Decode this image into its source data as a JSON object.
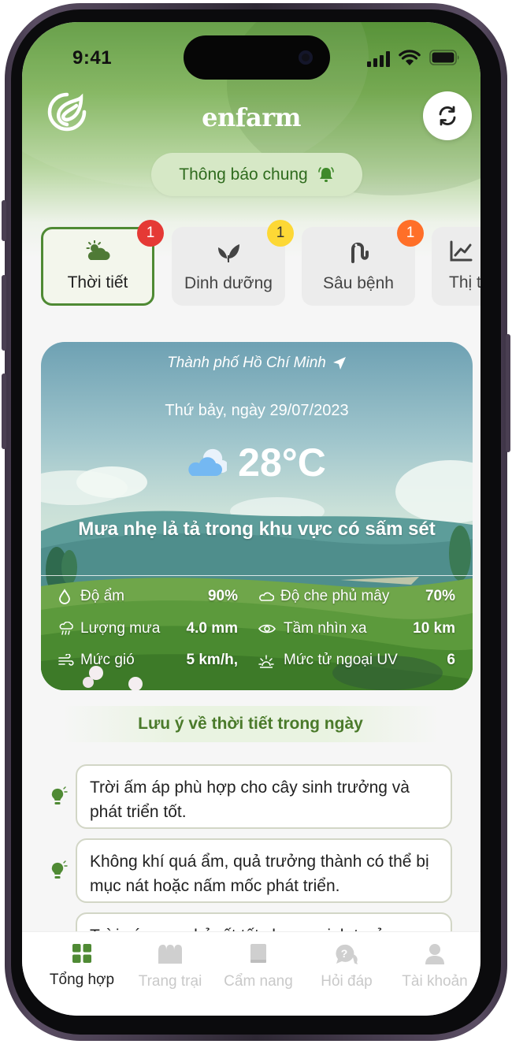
{
  "status_bar": {
    "time": "9:41"
  },
  "header": {
    "brand": "enfarm"
  },
  "notice": {
    "label": "Thông báo chung"
  },
  "tabs": [
    {
      "label": "Thời tiết",
      "badge": "1",
      "badge_color": "#e53935",
      "active": true,
      "icon": "weather-icon"
    },
    {
      "label": "Dinh dưỡng",
      "badge": "1",
      "badge_color": "#fdd835",
      "active": false,
      "icon": "leaf-icon"
    },
    {
      "label": "Sâu bệnh",
      "badge": "1",
      "badge_color": "#ff6f28",
      "active": false,
      "icon": "pest-icon"
    },
    {
      "label": "Thị tr",
      "badge": "",
      "active": false,
      "icon": "chart-icon"
    }
  ],
  "weather": {
    "city": "Thành phố Hồ Chí Minh",
    "date": "Thứ bảy, ngày 29/07/2023",
    "temperature": "28°C",
    "description": "Mưa nhẹ lả tả trong khu vực có sấm sét",
    "stats": {
      "humidity": {
        "label": "Độ ẩm",
        "value": "90%"
      },
      "cloud": {
        "label": "Độ che phủ mây",
        "value": "70%"
      },
      "rain": {
        "label": "Lượng mưa",
        "value": "4.0 mm"
      },
      "visibility": {
        "label": "Tầm nhìn xa",
        "value": "10 km"
      },
      "wind": {
        "label": "Mức gió",
        "value": "5 km/h,"
      },
      "uv": {
        "label": "Mức tử ngoại UV",
        "value": "6"
      }
    }
  },
  "notes": {
    "title": "Lưu ý về thời tiết trong ngày",
    "items": [
      "Trời ấm áp phù hợp cho cây sinh trưởng và phát triển tốt.",
      "Không khí quá ẩm, quả trưởng thành có thể bị mục nát hoặc nấm mốc phát triển.",
      "Trời có mưa nhỏ rất tốt cho sự sinh trưởng"
    ]
  },
  "bottom_nav": [
    {
      "label": "Tổng hợp",
      "active": true,
      "icon": "grid-icon"
    },
    {
      "label": "Trang trại",
      "active": false,
      "icon": "farm-icon"
    },
    {
      "label": "Cẩm nang",
      "active": false,
      "icon": "book-icon"
    },
    {
      "label": "Hỏi đáp",
      "active": false,
      "icon": "qa-icon"
    },
    {
      "label": "Tài khoản",
      "active": false,
      "icon": "user-icon"
    }
  ],
  "colors": {
    "primary": "#4f8a34",
    "accent_light": "#d6e8c6",
    "text_green": "#2f6b1e"
  }
}
